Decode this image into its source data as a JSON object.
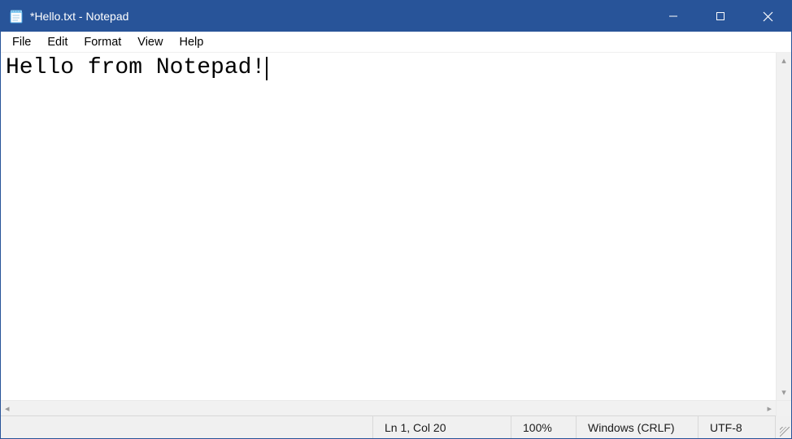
{
  "window": {
    "title": "*Hello.txt - Notepad"
  },
  "menu": {
    "items": [
      "File",
      "Edit",
      "Format",
      "View",
      "Help"
    ]
  },
  "editor": {
    "content": "Hello from Notepad!"
  },
  "status": {
    "cursor": "Ln 1, Col 20",
    "zoom": "100%",
    "line_ending": "Windows (CRLF)",
    "encoding": "UTF-8"
  }
}
